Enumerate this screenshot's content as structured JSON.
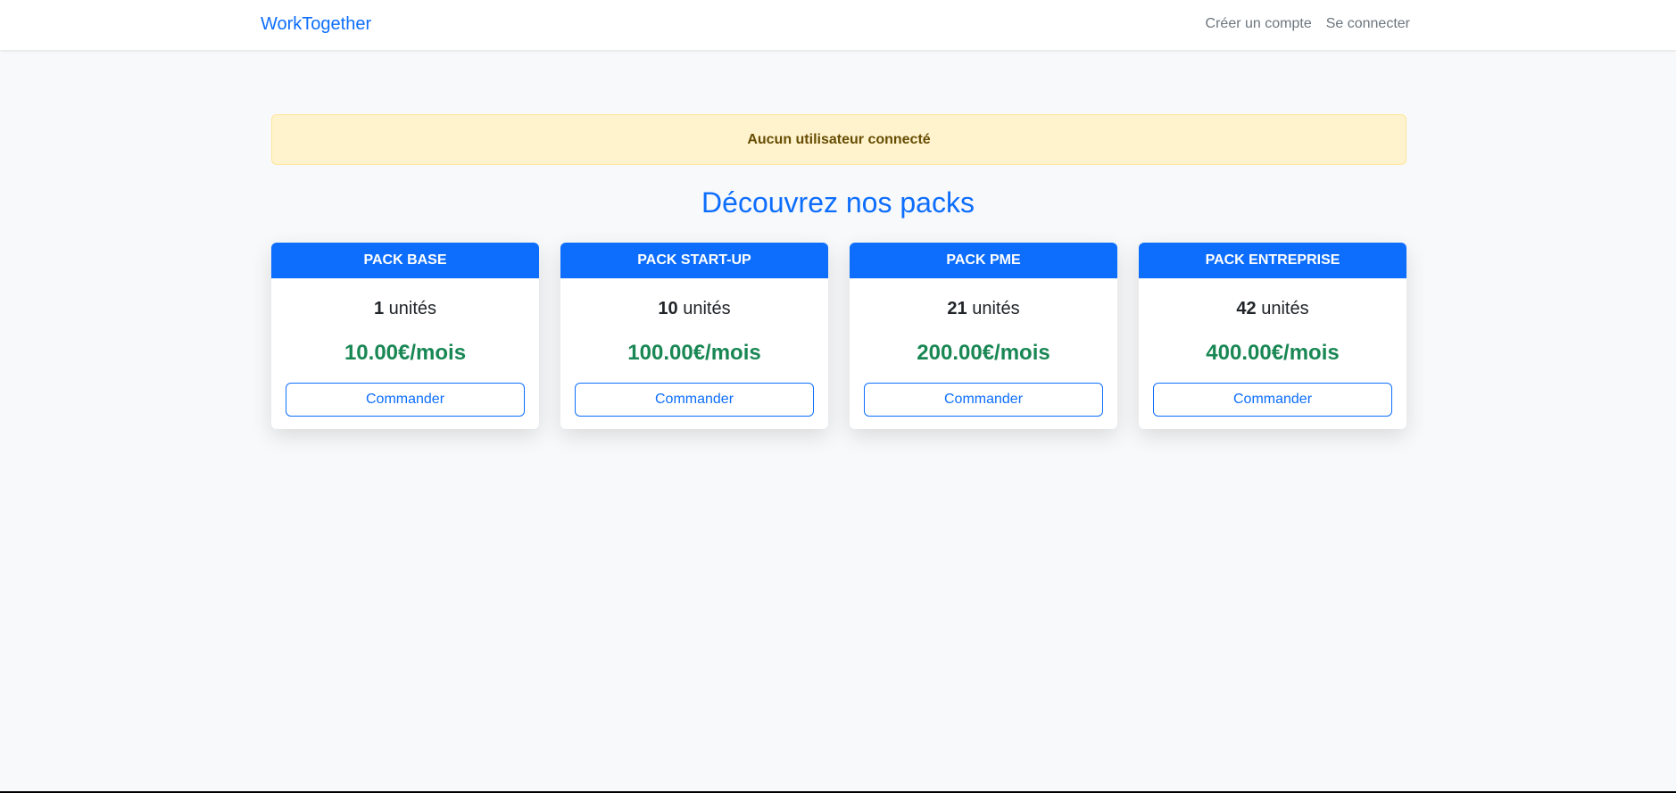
{
  "navbar": {
    "brand": "WorkTogether",
    "links": [
      {
        "label": "Créer un compte"
      },
      {
        "label": "Se connecter"
      }
    ]
  },
  "alert": {
    "text": "Aucun utilisateur connecté"
  },
  "title": "Découvrez nos packs",
  "packs": [
    {
      "name": "PACK BASE",
      "units": "1",
      "units_label": "unités",
      "price": "10.00€/mois",
      "button": "Commander"
    },
    {
      "name": "PACK START-UP",
      "units": "10",
      "units_label": "unités",
      "price": "100.00€/mois",
      "button": "Commander"
    },
    {
      "name": "PACK PME",
      "units": "21",
      "units_label": "unités",
      "price": "200.00€/mois",
      "button": "Commander"
    },
    {
      "name": "PACK ENTREPRISE",
      "units": "42",
      "units_label": "unités",
      "price": "400.00€/mois",
      "button": "Commander"
    }
  ],
  "colors": {
    "primary": "#0d6efd",
    "success": "#198754",
    "alert_bg": "#fff3cd",
    "alert_text": "#664d03",
    "page_bg": "#f8f9fa"
  }
}
